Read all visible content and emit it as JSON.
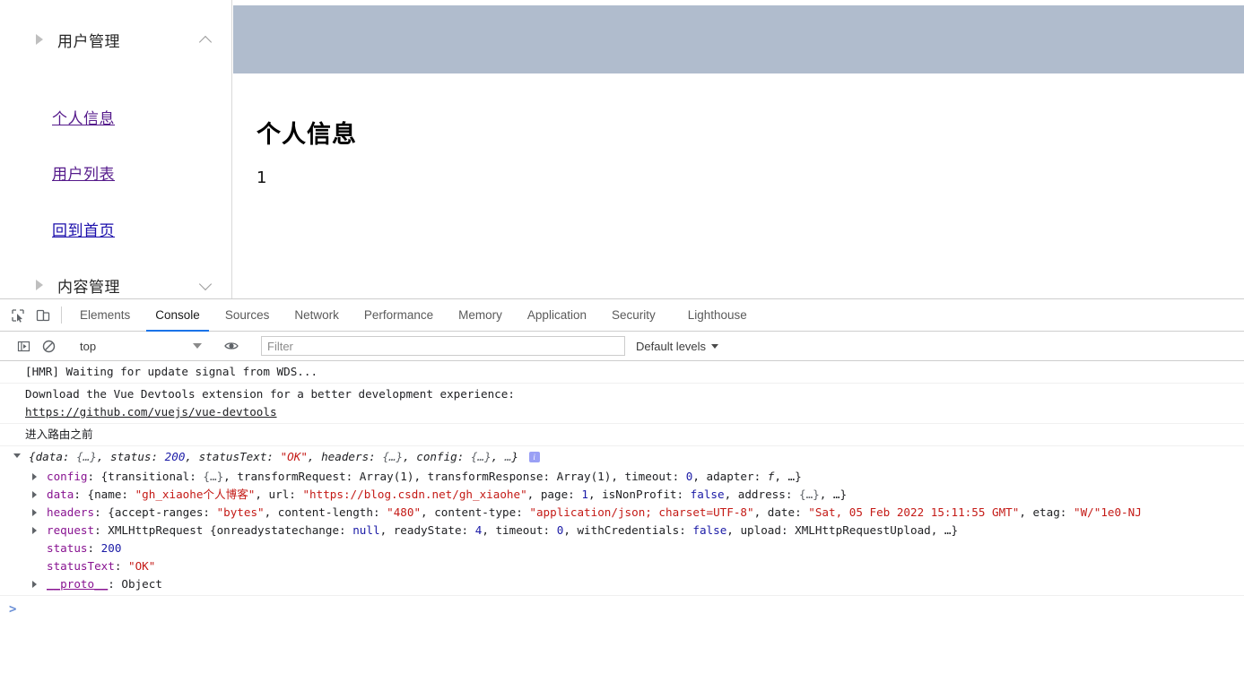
{
  "page": {
    "sidebar": {
      "groups": [
        {
          "label": "用户管理",
          "expanded": true,
          "chevron": "chevron-up-icon"
        },
        {
          "label": "内容管理",
          "expanded": false,
          "chevron": "chevron-down-icon"
        }
      ],
      "links": [
        {
          "label": "个人信息",
          "state": "visited"
        },
        {
          "label": "用户列表",
          "state": "visited"
        },
        {
          "label": "回到首页",
          "state": "unvisited"
        }
      ]
    },
    "content": {
      "banner_color": "#b0bccd",
      "title": "个人信息",
      "value": "1"
    }
  },
  "devtools": {
    "icons": {
      "inspect": "inspect-element-icon",
      "device": "device-toolbar-icon",
      "sidebar_toggle": "console-sidebar-icon",
      "clear": "clear-console-icon",
      "eye": "live-expression-icon"
    },
    "tabs": [
      {
        "label": "Elements",
        "active": false
      },
      {
        "label": "Console",
        "active": true
      },
      {
        "label": "Sources",
        "active": false
      },
      {
        "label": "Network",
        "active": false
      },
      {
        "label": "Performance",
        "active": false
      },
      {
        "label": "Memory",
        "active": false
      },
      {
        "label": "Application",
        "active": false
      },
      {
        "label": "Security",
        "active": false
      },
      {
        "label": "Lighthouse",
        "active": false
      }
    ],
    "active_tab_color": "#1a73e8",
    "console_toolbar": {
      "context": "top",
      "filter_value": "",
      "filter_placeholder": "Filter",
      "levels": "Default levels"
    },
    "log": {
      "hmr": "[HMR] Waiting for update signal from WDS...",
      "vue_devtools_text": "Download the Vue Devtools extension for a better development experience:",
      "vue_devtools_link": "https://github.com/vuejs/vue-devtools",
      "route_msg": "进入路由之前",
      "object_summary": {
        "open": "{",
        "parts": [
          {
            "key": "data: ",
            "value": "{…}",
            "type": "dim"
          },
          {
            "key": ", status: ",
            "value": "200",
            "type": "num"
          },
          {
            "key": ", statusText: ",
            "value": "\"OK\"",
            "type": "str"
          },
          {
            "key": ", headers: ",
            "value": "{…}",
            "type": "dim"
          },
          {
            "key": ", config: ",
            "value": "{…}",
            "type": "dim"
          },
          {
            "key": ", ",
            "value": "…",
            "type": "dim"
          }
        ],
        "close": "}"
      },
      "rows": [
        {
          "name": "config",
          "prefix": ": {",
          "segments": [
            {
              "t": "transitional: ",
              "c": "plain"
            },
            {
              "t": "{…}",
              "c": "dim"
            },
            {
              "t": ", transformRequest: Array(1), transformResponse: Array(1), timeout: ",
              "c": "plain"
            },
            {
              "t": "0",
              "c": "num"
            },
            {
              "t": ", adapter: ",
              "c": "plain"
            },
            {
              "t": "f",
              "c": "fn"
            },
            {
              "t": ", …}",
              "c": "plain"
            }
          ]
        },
        {
          "name": "data",
          "prefix": ": {",
          "segments": [
            {
              "t": "name: ",
              "c": "plain"
            },
            {
              "t": "\"gh_xiaohe个人博客\"",
              "c": "str"
            },
            {
              "t": ", url: ",
              "c": "plain"
            },
            {
              "t": "\"https://blog.csdn.net/gh_xiaohe\"",
              "c": "str"
            },
            {
              "t": ", page: ",
              "c": "plain"
            },
            {
              "t": "1",
              "c": "num"
            },
            {
              "t": ", isNonProfit: ",
              "c": "plain"
            },
            {
              "t": "false",
              "c": "bool"
            },
            {
              "t": ", address: ",
              "c": "plain"
            },
            {
              "t": "{…}",
              "c": "dim"
            },
            {
              "t": ", …}",
              "c": "plain"
            }
          ]
        },
        {
          "name": "headers",
          "prefix": ": {",
          "segments": [
            {
              "t": "accept-ranges: ",
              "c": "plain"
            },
            {
              "t": "\"bytes\"",
              "c": "str"
            },
            {
              "t": ", content-length: ",
              "c": "plain"
            },
            {
              "t": "\"480\"",
              "c": "str"
            },
            {
              "t": ", content-type: ",
              "c": "plain"
            },
            {
              "t": "\"application/json; charset=UTF-8\"",
              "c": "str"
            },
            {
              "t": ", date: ",
              "c": "plain"
            },
            {
              "t": "\"Sat, 05 Feb 2022 15:11:55 GMT\"",
              "c": "str"
            },
            {
              "t": ", etag: ",
              "c": "plain"
            },
            {
              "t": "\"W/\"1e0-NJ",
              "c": "str"
            }
          ]
        },
        {
          "name": "request",
          "prefix": ": XMLHttpRequest {",
          "segments": [
            {
              "t": "onreadystatechange: ",
              "c": "plain"
            },
            {
              "t": "null",
              "c": "null"
            },
            {
              "t": ", readyState: ",
              "c": "plain"
            },
            {
              "t": "4",
              "c": "num"
            },
            {
              "t": ", timeout: ",
              "c": "plain"
            },
            {
              "t": "0",
              "c": "num"
            },
            {
              "t": ", withCredentials: ",
              "c": "plain"
            },
            {
              "t": "false",
              "c": "bool"
            },
            {
              "t": ", upload: XMLHttpRequestUpload, …}",
              "c": "plain"
            }
          ]
        }
      ],
      "leaf_rows": [
        {
          "name": "status",
          "sep": ": ",
          "value": "200",
          "c": "num"
        },
        {
          "name": "statusText",
          "sep": ": ",
          "value": "\"OK\"",
          "c": "str"
        }
      ],
      "proto_row": {
        "name": "__proto__",
        "sep": ": ",
        "value": "Object"
      },
      "prompt": ">"
    }
  }
}
